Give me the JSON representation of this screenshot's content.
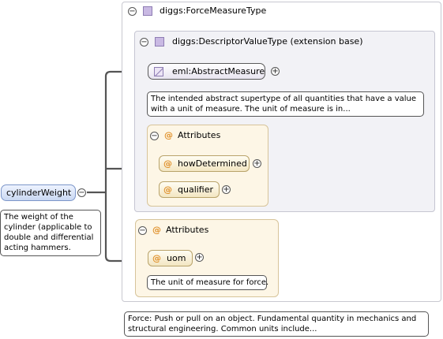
{
  "root": {
    "element_name": "cylinderWeight",
    "documentation": "The weight of the cylinder (applicable to double and differential acting hammers."
  },
  "force_type": {
    "name": "diggs:ForceMeasureType",
    "documentation": "Force: Push or pull on an object. Fundamental quantity in mechanics and structural engineering. Common units include..."
  },
  "base_type": {
    "name": "diggs:DescriptorValueType (extension base)"
  },
  "abstract_measure": {
    "name": "eml:AbstractMeasure",
    "documentation": "The intended abstract supertype of all quantities that have a value with a unit of measure. The unit of measure is in..."
  },
  "base_attributes": {
    "title": "Attributes",
    "at_symbol": "@",
    "items": [
      {
        "name": "howDetermined"
      },
      {
        "name": "qualifier"
      }
    ]
  },
  "force_attributes": {
    "title": "Attributes",
    "at_symbol": "@",
    "items": [
      {
        "name": "uom",
        "documentation": "The unit of measure for force."
      }
    ]
  },
  "symbols": {
    "collapse": "−",
    "expand": "+"
  },
  "colors": {
    "selected_element_fill": "#c9d8f2",
    "attribute_group_fill": "#fdf6e6",
    "type_icon": "#c9b9e3",
    "connector": "#555555"
  }
}
